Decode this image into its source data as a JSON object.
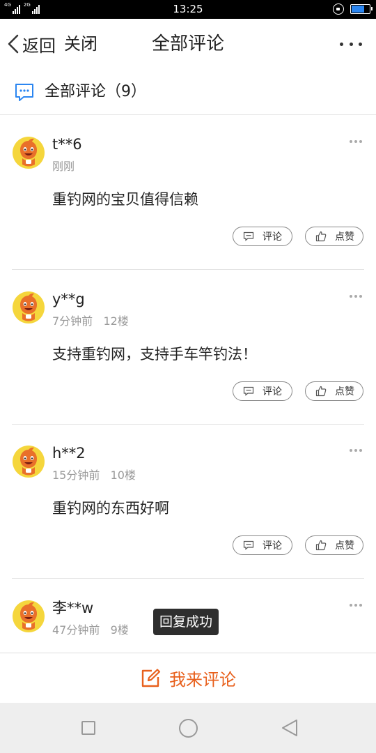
{
  "status_bar": {
    "network_left": "4G",
    "network_right": "2G",
    "time": "13:25",
    "battery_color": "#2b86f1"
  },
  "nav": {
    "back_label": "返回",
    "close_label": "关闭",
    "title": "全部评论"
  },
  "section": {
    "title": "全部评论（9）"
  },
  "comments": [
    {
      "user": "t**6",
      "meta": "刚刚",
      "text": "重钓网的宝贝值得信赖",
      "reply_label": "评论",
      "like_label": "点赞"
    },
    {
      "user": "y**g",
      "meta": "7分钟前   12楼",
      "text": "支持重钓网，支持手车竿钓法！",
      "reply_label": "评论",
      "like_label": "点赞"
    },
    {
      "user": "h**2",
      "meta": "15分钟前   10楼",
      "text": "重钓网的东西好啊",
      "reply_label": "评论",
      "like_label": "点赞"
    },
    {
      "user": "李**w",
      "meta": "47分钟前   9楼"
    }
  ],
  "toast": "回复成功",
  "comment_bar": {
    "label": "我来评论",
    "accent_color": "#e8601c"
  }
}
